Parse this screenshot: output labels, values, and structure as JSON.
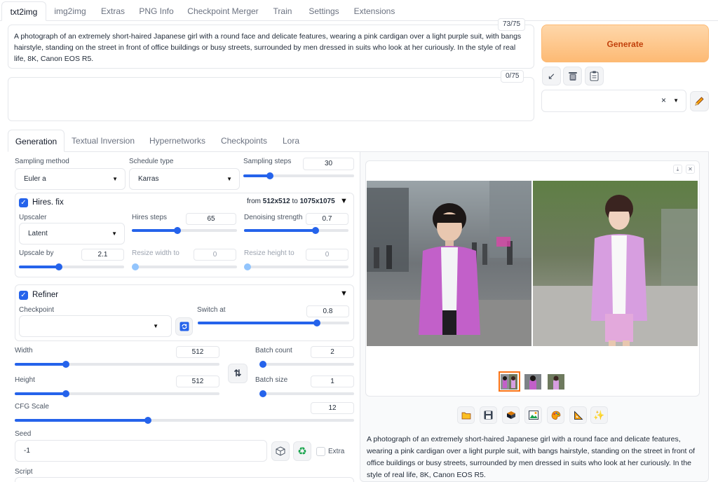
{
  "top_tabs": [
    "txt2img",
    "img2img",
    "Extras",
    "PNG Info",
    "Checkpoint Merger",
    "Train",
    "Settings",
    "Extensions"
  ],
  "prompt": {
    "text": "A photograph of an extremely short-haired Japanese girl with a round face and delicate features, wearing a pink cardigan over a light purple suit, with bangs hairstyle, standing on the street in front of office buildings or busy streets, surrounded by men dressed in suits who look at her curiously. In the style of real life, 8K, Canon EOS R5.",
    "counter": "73/75"
  },
  "negative_prompt": {
    "text": "",
    "counter": "0/75"
  },
  "generate_label": "Generate",
  "styles_clear": "×",
  "sub_tabs": [
    "Generation",
    "Textual Inversion",
    "Hypernetworks",
    "Checkpoints",
    "Lora"
  ],
  "sampling": {
    "method_label": "Sampling method",
    "method_value": "Euler a",
    "schedule_label": "Schedule type",
    "schedule_value": "Karras",
    "steps_label": "Sampling steps",
    "steps_value": "30",
    "steps_fraction": 0.22
  },
  "hires": {
    "title": "Hires. fix",
    "from_text": "from",
    "from_size": "512x512",
    "to_text": "to",
    "to_size": "1075x1075",
    "upscaler_label": "Upscaler",
    "upscaler_value": "Latent",
    "steps_label": "Hires steps",
    "steps_value": "65",
    "steps_fraction": 0.43,
    "denoise_label": "Denoising strength",
    "denoise_value": "0.7",
    "denoise_fraction": 0.7,
    "upscale_label": "Upscale by",
    "upscale_value": "2.1",
    "upscale_fraction": 0.37,
    "resize_w_label": "Resize width to",
    "resize_w_value": "0",
    "resize_h_label": "Resize height to",
    "resize_h_value": "0"
  },
  "refiner": {
    "title": "Refiner",
    "checkpoint_label": "Checkpoint",
    "checkpoint_value": "",
    "switch_label": "Switch at",
    "switch_value": "0.8",
    "switch_fraction": 0.8
  },
  "size": {
    "width_label": "Width",
    "width_value": "512",
    "width_fraction": 0.24,
    "height_label": "Height",
    "height_value": "512",
    "height_fraction": 0.24,
    "batch_count_label": "Batch count",
    "batch_count_value": "2",
    "batch_count_fraction": 0.0,
    "batch_size_label": "Batch size",
    "batch_size_value": "1",
    "batch_size_fraction": 0.0
  },
  "cfg": {
    "label": "CFG Scale",
    "value": "12",
    "fraction": 0.39
  },
  "seed": {
    "label": "Seed",
    "value": "-1",
    "extra_label": "Extra"
  },
  "script_label": "Script",
  "output_caption": "A photograph of an extremely short-haired Japanese girl with a round face and delicate features, wearing a pink cardigan over a light purple suit, with bangs hairstyle, standing on the street in front of office buildings or busy streets, surrounded by men dressed in suits who look at her curiously. In the style of real life, 8K, Canon EOS R5.",
  "colors": {
    "accent": "#2563eb",
    "generate": "#fdba74",
    "generate_text": "#c2410c",
    "selected_thumb": "#f97316"
  }
}
